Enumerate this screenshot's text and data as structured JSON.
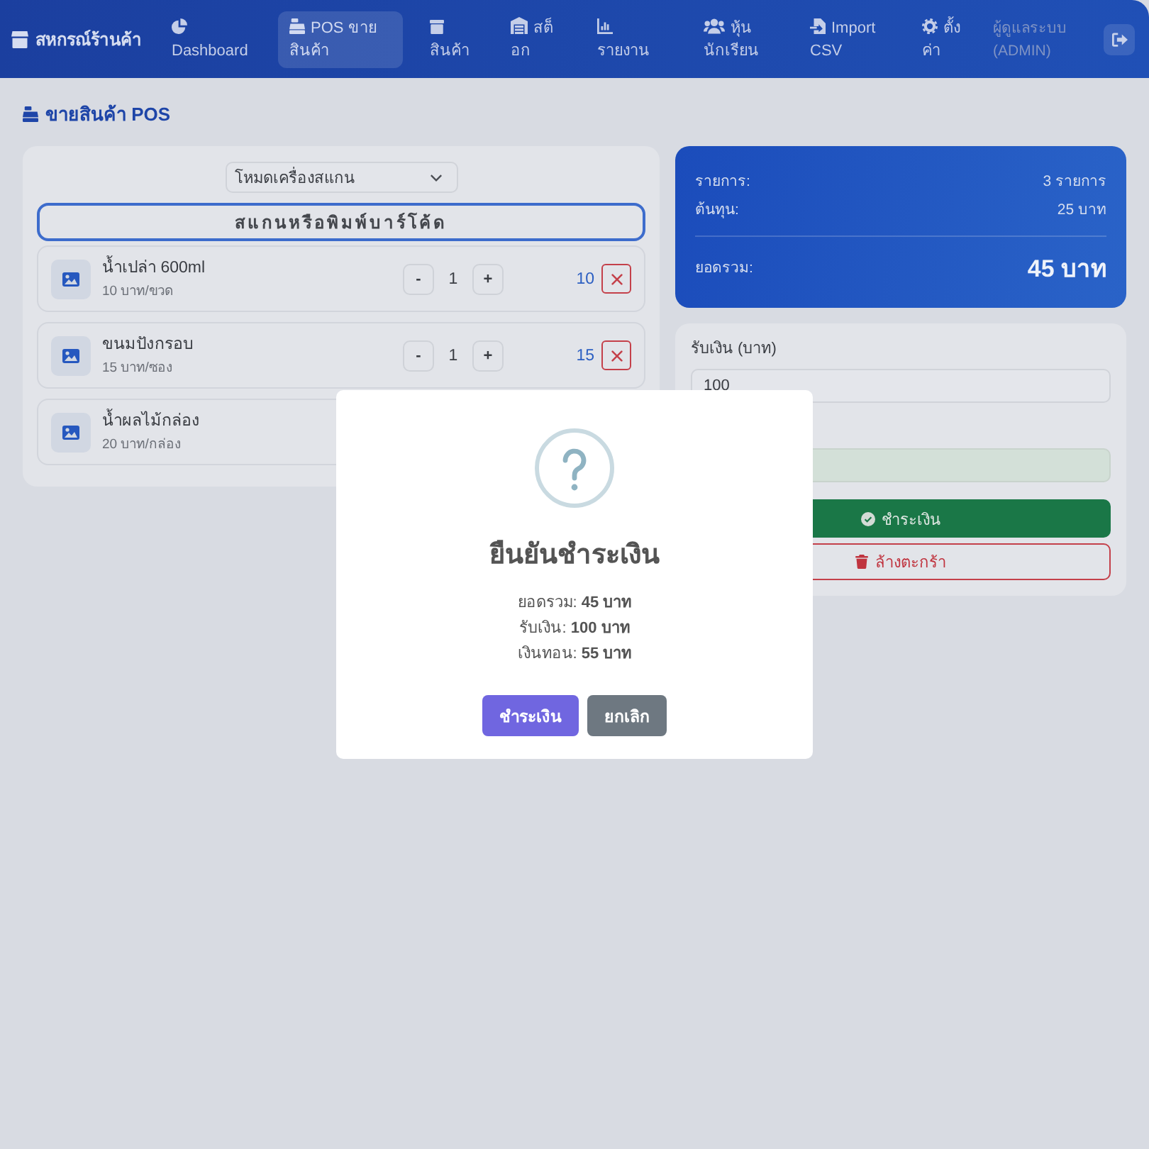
{
  "navbar": {
    "brand": "สหกรณ์ร้านค้า",
    "items": [
      {
        "label": "Dashboard",
        "selected": false
      },
      {
        "label": "POS ขายสินค้า",
        "selected": true
      },
      {
        "label": "สินค้า",
        "selected": false
      },
      {
        "label": "สต็อก",
        "selected": false
      },
      {
        "label": "รายงาน",
        "selected": false
      },
      {
        "label": "หุ้นนักเรียน",
        "selected": false
      },
      {
        "label": "Import CSV",
        "selected": false
      },
      {
        "label": "ตั้งค่า",
        "selected": false
      }
    ],
    "user": "ผู้ดูแลระบบ (ADMIN)"
  },
  "page": {
    "title": "ขายสินค้า POS"
  },
  "scanner": {
    "mode": "โหมดเครื่องสแกน",
    "barcode_placeholder": "สแกนหรือพิมพ์บาร์โค้ด"
  },
  "cart": [
    {
      "name": "น้ำเปล่า 600ml",
      "unit_price": "10 บาท/ขวด",
      "decrease_label": "-",
      "quantity": "1",
      "increase_label": "+",
      "total": "10"
    },
    {
      "name": "ขนมปังกรอบ",
      "unit_price": "15 บาท/ซอง",
      "decrease_label": "-",
      "quantity": "1",
      "increase_label": "+",
      "total": "15"
    },
    {
      "name": "น้ำผลไม้กล่อง",
      "unit_price": "20 บาท/กล่อง"
    }
  ],
  "summary": {
    "rows": [
      {
        "label": "รายการ:",
        "value": "3 รายการ"
      },
      {
        "label": "ต้นทุน:",
        "value": "25 บาท"
      }
    ],
    "total_label": "ยอดรวม:",
    "total_value": "45 บาท"
  },
  "payment": {
    "received_label": "รับเงิน (บาท)",
    "received_value": "100",
    "change_field": {
      "readonly": true
    },
    "pay_button": "ชำระเงิน",
    "clear_button": "ล้างตะกร้า"
  },
  "dialog": {
    "title": "ยืนยันชำระเงิน",
    "lines": [
      "ยอดรวม: **45 บาท**",
      "รับเงิน: **100 บาท**",
      "เงินทอน: **55 บาท**"
    ],
    "buttons": [
      {
        "label": "ชำระเงิน",
        "kind": "confirm"
      },
      {
        "label": "ยกเลิก",
        "kind": "cancel"
      }
    ]
  }
}
